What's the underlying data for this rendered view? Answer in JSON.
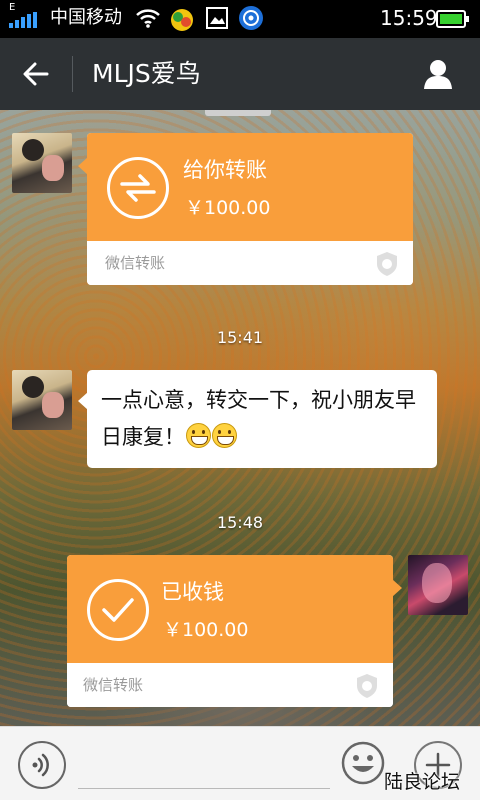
{
  "status_bar": {
    "network_type": "E",
    "carrier": "中国移动",
    "time": "15:59",
    "icons": [
      "signal-icon",
      "wifi-icon",
      "app-notification-icon",
      "image-icon",
      "browser-notification-icon",
      "battery-icon"
    ]
  },
  "header": {
    "back_icon": "back-arrow-icon",
    "title": "MLJS爱鸟",
    "profile_icon": "person-icon",
    "background_color": "#2d3134"
  },
  "messages": [
    {
      "type": "transfer",
      "side": "left",
      "avatar": "avatar-contact",
      "icon": "transfer-arrows-icon",
      "title": "给你转账",
      "amount": "￥100.00",
      "footer": "微信转账",
      "card_color": "#f99e3b"
    },
    {
      "type": "time",
      "text": "15:41"
    },
    {
      "type": "text",
      "side": "left",
      "avatar": "avatar-contact",
      "text": "一点心意，转交一下，祝小朋友早日康复！",
      "emojis": [
        "grin-emoji",
        "grin-emoji"
      ]
    },
    {
      "type": "time",
      "text": "15:48"
    },
    {
      "type": "transfer",
      "side": "right",
      "avatar": "avatar-self",
      "icon": "checkmark-icon",
      "title": "已收钱",
      "amount": "￥100.00",
      "footer": "微信转账",
      "card_color": "#f99e3b"
    }
  ],
  "input_bar": {
    "voice_icon": "voice-icon",
    "emoji_icon": "smiley-icon",
    "plus_icon": "plus-icon"
  },
  "watermark": "陆良论坛"
}
